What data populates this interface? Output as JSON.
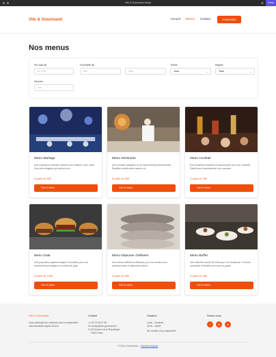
{
  "browser": {
    "title": "Vite & Gourmand Setup",
    "action_label": "Perso"
  },
  "header": {
    "logo": "Vite & Gourmand",
    "nav": [
      "Accueil",
      "Menus",
      "Contact"
    ],
    "cta": "Connexion",
    "active_nav": "Menus"
  },
  "page": {
    "title": "Nos menus"
  },
  "filters": {
    "prix_max": {
      "label": "Prix max (€)",
      "placeholder": "ex. 100"
    },
    "fourchette": {
      "label": "Fourchette (€)",
      "min_placeholder": "min",
      "max_placeholder": "max"
    },
    "theme": {
      "label": "Thème",
      "value": "Tous"
    },
    "regime": {
      "label": "Régime",
      "value": "Tous"
    },
    "min_pers": {
      "label": "Min pers.",
      "placeholder": "min"
    }
  },
  "cards": [
    {
      "title": "Menu Mariage",
      "desc": "Une expérience culinaire raffinée pour célébrer votre union. Des mets élégants qui raviront vos...",
      "price": "À partir de 80€",
      "button": "Voir le menu"
    },
    {
      "title": "Menu Séminaire",
      "desc": "Des formules adaptées à vos événements professionnels. Équilibre parfait entre saveurs et...",
      "price": "À partir de 40€",
      "button": "Voir le menu"
    },
    {
      "title": "Menu Cocktail",
      "desc": "Des bouchées créatives et savoureuses pour vos cocktails. Parfait pour impressionner vos convives.",
      "price": "À partir de 30€",
      "button": "Voir le menu"
    },
    {
      "title": "Menu Gala",
      "desc": "Une proposition gastronomique d'exception pour vos événements prestigieux et soirées de gala.",
      "price": "À partir de 120€",
      "button": "Voir le menu"
    },
    {
      "title": "Menu Déjeuner d'affaires",
      "desc": "Des menus raffinés et efficaces pour vos rendez-vous professionnels et déjeuners clients.",
      "price": "À partir de 35€",
      "button": "Voir le menu"
    },
    {
      "title": "Menu Buffet",
      "desc": "Une sélection variée de mets pour vos réceptions. Formule conviviale et flexible pour tous les goûts.",
      "price": "À partir de 45€",
      "button": "Voir le menu"
    }
  ],
  "footer": {
    "brand": "Vite & Gourmand",
    "brand_text": "Votre partenaire de confiance pour la restauration événementielle depuis 25 ans.",
    "contact_title": "Contact",
    "phone": "01 23 45 67 89",
    "email": "contact@vite-gourmand.fr",
    "address_line1": "123 Avenue de la République",
    "address_line2": "75011 Paris",
    "hours_title": "Horaires",
    "hours_days": "Lundi - Vendredi",
    "hours_time": "09:00 - 18h00",
    "hours_note": "Sur rendez-vous uniquement",
    "social_title": "Suivez-nous",
    "copyright": "© Vite & Gourmand —",
    "legal_link": "Mentions légales"
  },
  "colors": {
    "accent": "#f04e0c",
    "footer_bg": "#f4f4f4"
  }
}
